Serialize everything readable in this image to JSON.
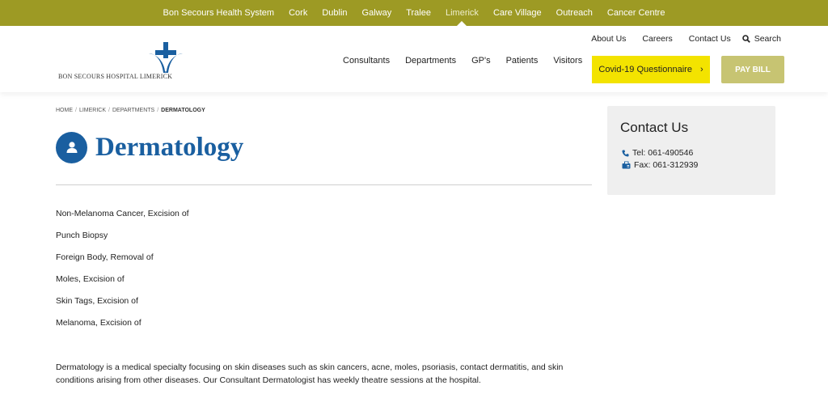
{
  "topbar": {
    "items": [
      {
        "label": "Bon Secours Health System"
      },
      {
        "label": "Cork"
      },
      {
        "label": "Dublin"
      },
      {
        "label": "Galway"
      },
      {
        "label": "Tralee"
      },
      {
        "label": "Limerick"
      },
      {
        "label": "Care Village"
      },
      {
        "label": "Outreach"
      },
      {
        "label": "Cancer Centre"
      }
    ],
    "active": "Limerick"
  },
  "header": {
    "logo_text": "BON SECOURS HOSPITAL LIMERICK",
    "utility": [
      {
        "label": "About Us"
      },
      {
        "label": "Careers"
      },
      {
        "label": "Contact Us"
      }
    ],
    "search_label": "Search",
    "nav": [
      {
        "label": "Consultants"
      },
      {
        "label": "Departments"
      },
      {
        "label": "GP's"
      },
      {
        "label": "Patients"
      },
      {
        "label": "Visitors"
      }
    ],
    "covid_label": "Covid-19 Questionnaire",
    "pay_label": "PAY BILL"
  },
  "breadcrumb": {
    "items": [
      "HOME",
      "LIMERICK",
      "DEPARTMENTS"
    ],
    "current": "DERMATOLOGY",
    "separator": "/"
  },
  "page": {
    "title": "Dermatology",
    "procedures": [
      "Non-Melanoma Cancer, Excision of",
      "Punch Biopsy",
      "Foreign Body, Removal of",
      "Moles, Excision of",
      "Skin Tags, Excision of",
      "Melanoma, Excision of"
    ],
    "description": "Dermatology is a medical specialty focusing on skin diseases such as skin cancers, acne, moles, psoriasis, contact dermatitis, and skin conditions arising from other diseases. Our Consultant Dermatologist has weekly theatre sessions at the hospital."
  },
  "contact": {
    "title": "Contact Us",
    "tel": "Tel: 061-490546",
    "fax": "Fax: 061-312939"
  },
  "colors": {
    "topbar": "#9d9a24",
    "brand_blue": "#1a5fa0",
    "covid_yellow": "#f3e300",
    "pay_green": "#c7c472"
  }
}
